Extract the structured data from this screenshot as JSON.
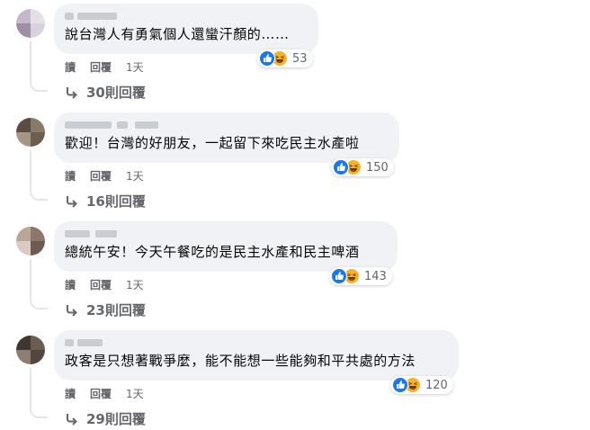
{
  "comments": [
    {
      "text": "說台灣人有勇氣個人還蠻汗顏的……",
      "reaction_count": "53",
      "actions": {
        "read": "讀",
        "reply": "回覆",
        "time": "1天"
      },
      "replies_label": "30則回覆",
      "avatar_colors": [
        "#c4b9c8",
        "#e5e0e8",
        "#9e8fa5",
        "#d8d2dc",
        "#b7adbf",
        "#ede9f0",
        "#a598ad",
        "#cfc7d4"
      ]
    },
    {
      "text": "歡迎！台灣的好朋友，一起留下來吃民主水產啦",
      "reaction_count": "150",
      "actions": {
        "read": "讀",
        "reply": "回覆",
        "time": "1天"
      },
      "replies_label": "16則回覆",
      "avatar_colors": [
        "#5a4c40",
        "#8a7a6c",
        "#3f352d",
        "#a59585",
        "#6e5e50",
        "#c1b2a3",
        "#4e4238",
        "#7d6d5f"
      ]
    },
    {
      "text": "總統午安！今天午餐吃的是民主水產和民主啤酒",
      "reaction_count": "143",
      "actions": {
        "read": "讀",
        "reply": "回覆",
        "time": "1天"
      },
      "replies_label": "23則回覆",
      "avatar_colors": [
        "#b8a69a",
        "#8d776c",
        "#d9cbc1",
        "#6d5a50",
        "#c7b4a8",
        "#9b8478",
        "#e6dad2",
        "#7a665c"
      ]
    },
    {
      "text": "政客是只想著戰爭麼，能不能想一些能夠和平共處的方法",
      "reaction_count": "120",
      "actions": {
        "read": "讀",
        "reply": "回覆",
        "time": "1天"
      },
      "replies_label": "29則回覆",
      "avatar_colors": [
        "#3d3631",
        "#6b5d52",
        "#2a2521",
        "#8e7e70",
        "#514740",
        "#a39282",
        "#473e37",
        "#7c6c5f"
      ]
    }
  ],
  "colors": {
    "bubble": "#f0f2f5",
    "like": "#1877f2",
    "haha": "#f7b125",
    "secondary_text": "#65676b"
  },
  "icons": {
    "like": "thumbs-up-icon",
    "haha": "laughing-face-icon",
    "reply_arrow": "reply-arrow-icon"
  }
}
